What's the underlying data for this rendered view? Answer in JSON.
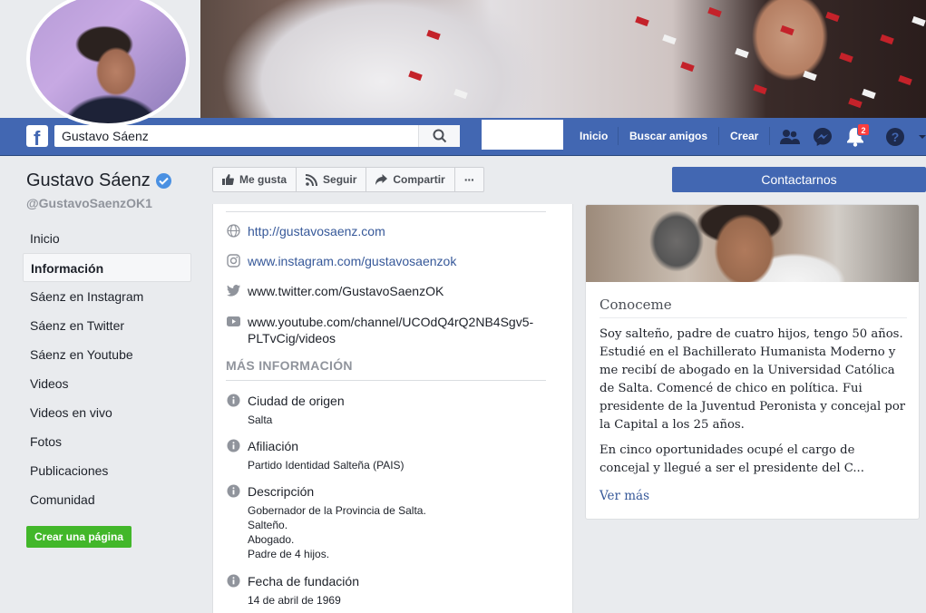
{
  "header": {
    "search_value": "Gustavo Sáenz",
    "nav": [
      "Inicio",
      "Buscar amigos",
      "Crear"
    ],
    "notification_count": "2",
    "logo_letter": "f"
  },
  "page": {
    "name": "Gustavo Sáenz",
    "handle": "@GustavoSaenzOK1",
    "create_page_label": "Crear una página"
  },
  "sidebar": {
    "items": [
      {
        "label": "Inicio"
      },
      {
        "label": "Información",
        "active": true
      },
      {
        "label": "Sáenz en Instagram"
      },
      {
        "label": "Sáenz en Twitter"
      },
      {
        "label": "Sáenz en Youtube"
      },
      {
        "label": "Videos"
      },
      {
        "label": "Videos en vivo"
      },
      {
        "label": "Fotos"
      },
      {
        "label": "Publicaciones"
      },
      {
        "label": "Comunidad"
      }
    ]
  },
  "actions": {
    "like": "Me gusta",
    "follow": "Seguir",
    "share": "Compartir",
    "more": "···",
    "contact": "Contactarnos"
  },
  "links": {
    "website": "http://gustavosaenz.com",
    "instagram": "www.instagram.com/gustavosaenzok",
    "twitter": "www.twitter.com/GustavoSaenzOK",
    "youtube_line1": "www.youtube.com/channel/UCOdQ4rQ2NB4Sgv5-",
    "youtube_line2": "PLTvCig/videos"
  },
  "more_info": {
    "title": "MÁS INFORMACIÓN",
    "origin_label": "Ciudad de origen",
    "origin_value": "Salta",
    "affiliation_label": "Afiliación",
    "affiliation_value": "Partido Identidad Salteña (PAIS)",
    "description_label": "Descripción",
    "description_lines": [
      "Gobernador de la Provincia de Salta.",
      "Salteño.",
      "Abogado.",
      "Padre de 4 hijos."
    ],
    "founded_label": "Fecha de fundación",
    "founded_value": "14 de abril de 1969"
  },
  "about_card": {
    "title": "Conoceme",
    "paragraph1": "Soy salteño, padre de cuatro hijos, tengo 50 años. Estudié en el Bachillerato Humanista Moderno y me recibí de abogado en la Universidad Católica de Salta. Comencé de chico en política. Fui presidente de la Juventud Peronista y concejal por la Capital a los 25 años.",
    "paragraph2": "En cinco oportunidades ocupé el cargo de concejal y llegué a ser el presidente del C...",
    "see_more": "Ver más"
  }
}
